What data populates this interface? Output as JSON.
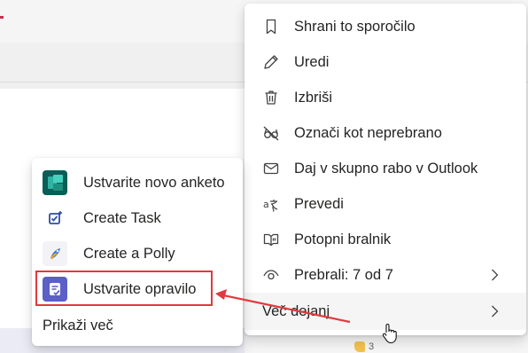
{
  "main_menu": {
    "items": [
      {
        "label": "Shrani to sporočilo",
        "icon": "bookmark-icon"
      },
      {
        "label": "Uredi",
        "icon": "pencil-icon"
      },
      {
        "label": "Izbriši",
        "icon": "trash-icon"
      },
      {
        "label": "Označi kot neprebrano",
        "icon": "eye-off-icon"
      },
      {
        "label": "Daj v skupno rabo v Outlook",
        "icon": "mail-icon"
      },
      {
        "label": "Prevedi",
        "icon": "translate-icon"
      },
      {
        "label": "Potopni bralnik",
        "icon": "immersive-reader-icon"
      },
      {
        "label": "Prebrali: 7 od 7",
        "icon": "eye-icon"
      },
      {
        "label": "Več dejanj",
        "icon": ""
      }
    ]
  },
  "sub_menu": {
    "items": [
      {
        "label": "Ustvarite novo anketo",
        "icon": "forms-app-icon"
      },
      {
        "label": "Create Task",
        "icon": "task-app-icon"
      },
      {
        "label": "Create a Polly",
        "icon": "polly-app-icon"
      },
      {
        "label": "Ustvarite opravilo",
        "icon": "planner-app-icon"
      }
    ],
    "show_more": "Prikaži več"
  },
  "reaction": {
    "count": "3"
  },
  "colors": {
    "highlight": "#e0393e",
    "menu_bg": "#ffffff",
    "hover_bg": "#f5f5f5",
    "planner_purple": "#5b5fc7"
  }
}
